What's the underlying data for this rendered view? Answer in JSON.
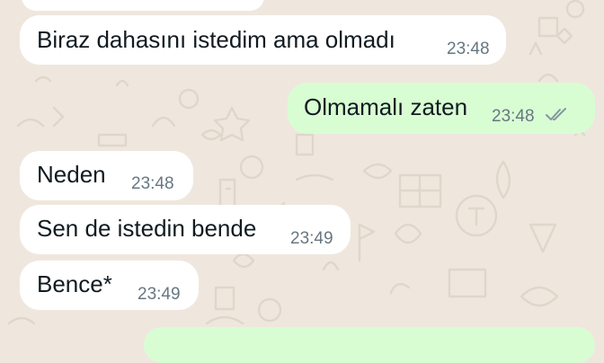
{
  "chat": {
    "messages": [
      {
        "direction": "incoming",
        "text": "Biraz dahasını istedim ama olmadı",
        "time": "23:48"
      },
      {
        "direction": "outgoing",
        "text": "Olmamalı zaten",
        "time": "23:48",
        "status": "read-double-check-icon"
      },
      {
        "direction": "incoming",
        "text": "Neden",
        "time": "23:48"
      },
      {
        "direction": "incoming",
        "text": "Sen de istedin bende",
        "time": "23:49"
      },
      {
        "direction": "incoming",
        "text": "Bence*",
        "time": "23:49"
      }
    ]
  },
  "colors": {
    "wallpaper": "#efe7de",
    "incoming_bubble": "#ffffff",
    "outgoing_bubble": "#d9fdd3",
    "timestamp": "#667781"
  }
}
